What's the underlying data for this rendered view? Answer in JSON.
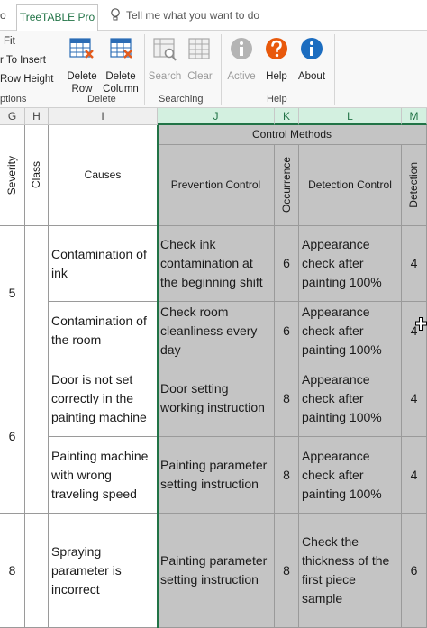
{
  "ribbon": {
    "prev_tab_fragment": "o",
    "active_tab": "TreeTABLE Pro",
    "tell_me": "Tell me what you want to do",
    "left_items": [
      "Fit",
      "r To Insert",
      "Row Height"
    ],
    "left_group_label": "ptions",
    "delete_group": {
      "label": "Delete",
      "delete_row": "Delete\nRow",
      "delete_row_l1": "Delete",
      "delete_row_l2": "Row",
      "delete_col_l1": "Delete",
      "delete_col_l2": "Column"
    },
    "search_group": {
      "label": "Searching",
      "search": "Search",
      "clear": "Clear"
    },
    "help_group": {
      "label": "Help",
      "active": "Active",
      "help": "Help",
      "about": "About"
    }
  },
  "columns": [
    "G",
    "H",
    "I",
    "J",
    "K",
    "L",
    "M"
  ],
  "headers": {
    "severity": "Severity",
    "class": "Class",
    "causes": "Causes",
    "control_methods": "Control Methods",
    "prevention": "Prevention Control",
    "occurrence": "Occurrence",
    "detection_control": "Detection Control",
    "detection": "Detection"
  },
  "rows": [
    {
      "severity": "5",
      "cause": "Contamination of ink",
      "prevention": "Check ink contamination at the beginning shift",
      "occurrence": "6",
      "detection_control": "Appearance check after painting 100%",
      "detection": "4"
    },
    {
      "severity": "",
      "cause": "Contamination of the room",
      "prevention": "Check room cleanliness every day",
      "occurrence": "6",
      "detection_control": "Appearance check after painting 100%",
      "detection": "4"
    },
    {
      "severity": "6",
      "cause": "Door is not set correctly in the painting machine",
      "prevention": "Door setting working instruction",
      "occurrence": "8",
      "detection_control": "Appearance check after painting 100%",
      "detection": "4"
    },
    {
      "severity": "",
      "cause": "Painting machine with wrong traveling speed",
      "prevention": "Painting parameter setting instruction",
      "occurrence": "8",
      "detection_control": "Appearance check after painting 100%",
      "detection": "4"
    },
    {
      "severity": "8",
      "cause": "Spraying parameter is incorrect",
      "prevention": "Painting parameter setting instruction",
      "occurrence": "8",
      "detection_control": "Check the thickness of the first piece sample",
      "detection": "6"
    }
  ],
  "colors": {
    "accent": "#217346",
    "selection_fill": "#c4c4c4",
    "help_orange": "#e8590c",
    "about_blue": "#1c6dc0"
  }
}
